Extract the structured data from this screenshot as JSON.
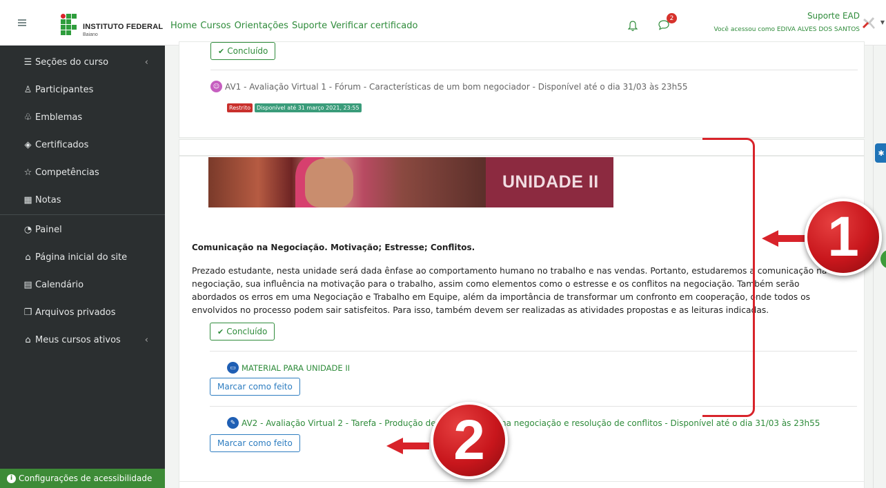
{
  "brand": {
    "name": "INSTITUTO FEDERAL",
    "subname": "Baiano"
  },
  "sidebar": {
    "items": [
      {
        "label": "Seções do curso",
        "icon": "list-icon",
        "caret": "‹"
      },
      {
        "label": "Participantes",
        "icon": "users-icon"
      },
      {
        "label": "Emblemas",
        "icon": "badge-icon"
      },
      {
        "label": "Certificados",
        "icon": "certificate-icon"
      },
      {
        "label": "Competências",
        "icon": "star-icon"
      },
      {
        "label": "Notas",
        "icon": "table-icon"
      },
      {
        "label": "Painel",
        "icon": "dashboard-icon"
      },
      {
        "label": "Página inicial do site",
        "icon": "home-icon"
      },
      {
        "label": "Calendário",
        "icon": "calendar-icon"
      },
      {
        "label": "Arquivos privados",
        "icon": "files-icon"
      },
      {
        "label": "Meus cursos ativos",
        "icon": "graduation-cap-icon",
        "caret": "‹"
      }
    ],
    "accessibility_label": "Configurações de acessibilidade"
  },
  "topnav": {
    "links": [
      "Home",
      "Cursos",
      "Orientações",
      "Suporte",
      "Verificar certificado"
    ],
    "notification_count": "2",
    "user_name": "Suporte EAD",
    "user_access": "Você acessou como EDIVA ALVES DOS SANTOS"
  },
  "content": {
    "done_label": "Concluído",
    "av1": {
      "title": "AV1 - Avaliação Virtual 1 - Fórum - Características de um bom negociador - Disponível até o dia 31/03 às 23h55",
      "tag_restricted": "Restrito",
      "tag_available": "Disponível até 31 março 2021, 23:55"
    },
    "banner_label": "UNIDADE II",
    "section_title": "Comunicação na Negociação. Motivação; Estresse; Conflitos.",
    "section_text": "Prezado estudante, nesta unidade será dada ênfase ao comportamento humano no trabalho e nas vendas. Portanto, estudaremos a comunicação na negociação, sua influência na motivação para o trabalho, assim como elementos como o estresse e os conflitos na negociação. Também serão abordados os erros em uma Negociação e Trabalho em Equipe, além da importância de transformar um confronto em cooperação, onde todos os envolvidos no processo podem sair satisfeitos. Para isso, também devem ser realizadas as atividades propostas e as leituras indicadas.",
    "material": {
      "title": "MATERIAL PARA UNIDADE II"
    },
    "av2": {
      "title_part1": "AV2 - Avaliação Virtual 2 - Tarefa - Produção de",
      "title_part2": "so na negociação e resolução de conflitos - Disponível até o dia 31/03 às 23h55"
    },
    "mark_done_label": "Marcar como feito"
  },
  "annotations": {
    "num1": "1",
    "num2": "2"
  },
  "colors": {
    "accent_green": "#2e8b3a",
    "link_blue": "#2c7cc0",
    "sidebar_bg": "#2b2f30",
    "annotation_red": "#d8232a",
    "banner_purple": "#8c2a40"
  }
}
